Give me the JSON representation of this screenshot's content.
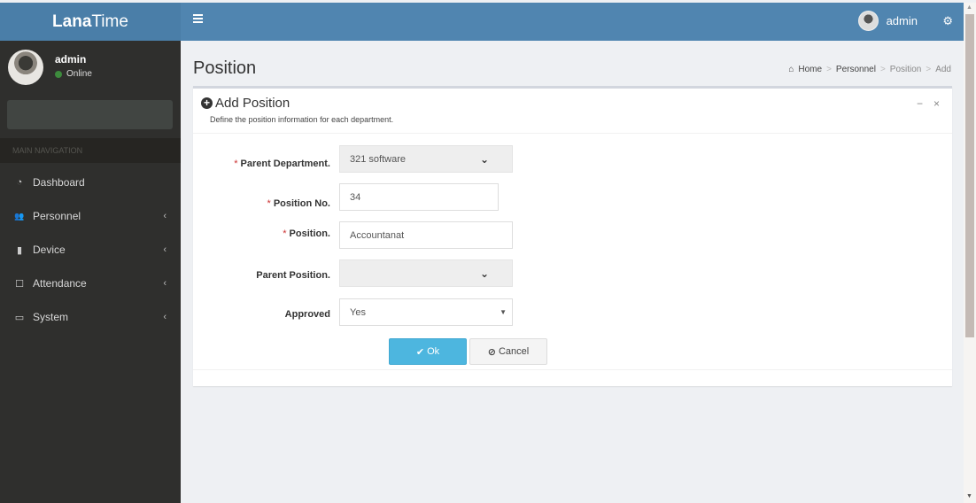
{
  "app": {
    "brand_bold": "Lana",
    "brand_rest": "Time"
  },
  "topbar": {
    "menu_icon": "hamburger-icon",
    "user_name": "admin",
    "settings_icon": "gears-icon"
  },
  "sidebar": {
    "user": {
      "name": "admin",
      "status": "Online",
      "status_color": "#3d8b3d"
    },
    "nav_header": "MAIN NAVIGATION",
    "items": [
      {
        "label": "Dashboard",
        "icon": "dashboard-icon",
        "glyph": "◔",
        "has_children": false
      },
      {
        "label": "Personnel",
        "icon": "users-icon",
        "glyph": "👥",
        "has_children": true
      },
      {
        "label": "Device",
        "icon": "device-icon",
        "glyph": "▮",
        "has_children": true
      },
      {
        "label": "Attendance",
        "icon": "sticky-note-icon",
        "glyph": "☐",
        "has_children": true
      },
      {
        "label": "System",
        "icon": "laptop-icon",
        "glyph": "▭",
        "has_children": true
      }
    ],
    "chevron": "‹"
  },
  "page": {
    "title": "Position",
    "breadcrumb": [
      "Home",
      "Personnel",
      "Position",
      "Add"
    ],
    "breadcrumb_sep": ">"
  },
  "box": {
    "title": "Add Position",
    "description": "Define the position information for each department.",
    "minimize": "−",
    "close": "×"
  },
  "form": {
    "required_mark": "*",
    "parent_department": {
      "label": "Parent Department.",
      "value": "321 software",
      "required": true
    },
    "position_no": {
      "label": "Position No.",
      "value": "34",
      "required": true
    },
    "position": {
      "label": "Position.",
      "value": "Accountanat",
      "required": true
    },
    "parent_position": {
      "label": "Parent Position.",
      "value": "",
      "required": false
    },
    "approved": {
      "label": "Approved",
      "value": "Yes",
      "required": false
    },
    "ok_label": "Ok",
    "cancel_label": "Cancel"
  },
  "colors": {
    "header": "#5085b0",
    "logo": "#4a7ea8",
    "sidebar": "#2f2f2d",
    "primary_button": "#4db6df"
  }
}
